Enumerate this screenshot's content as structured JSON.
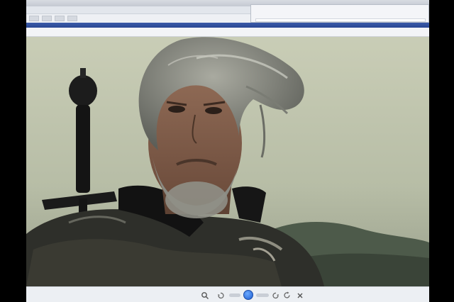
{
  "window": {
    "title": "",
    "menu": [],
    "panel_title": "",
    "panel_tabs": [],
    "tabs": []
  },
  "viewer": {
    "image_description": ""
  },
  "navigation": {
    "buttons": [
      {
        "icon": "search-icon"
      },
      {
        "icon": "rotate-left-icon"
      },
      {
        "icon": "zoom-slider-icon"
      },
      {
        "icon": "play-slideshow-icon"
      },
      {
        "icon": "zoom-slider-icon"
      },
      {
        "icon": "rotate-right-icon"
      },
      {
        "icon": "refresh-icon"
      },
      {
        "icon": "delete-icon"
      }
    ]
  },
  "colors": {
    "accent_bar": "#2b4793",
    "play_button": "#1f5ed1",
    "chrome": "#e9ecf1"
  }
}
